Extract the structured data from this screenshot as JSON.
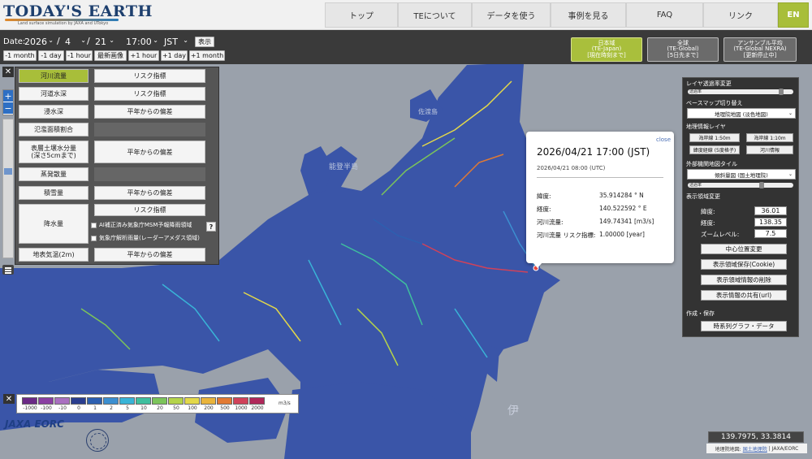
{
  "header": {
    "logo_text": "TODAY'S EARTH",
    "logo_sub": "Land surface simulation by JAXA and UTokyo",
    "nav": [
      {
        "label": "トップ"
      },
      {
        "label": "TEについて"
      },
      {
        "label": "データを使う"
      },
      {
        "label": "事例を見る"
      },
      {
        "label": "FAQ"
      },
      {
        "label": "リンク"
      }
    ],
    "lang": "EN"
  },
  "toolbar": {
    "date_label": "Date:",
    "year": "2026",
    "month": "4",
    "day": "21",
    "time": "17:00",
    "tz": "JST",
    "show": "表示",
    "steps": [
      "-1 month",
      "-1 day",
      "-1 hour",
      "最新画像",
      "+1 hour",
      "+1 day",
      "+1 month"
    ],
    "models": [
      {
        "l1": "日本域",
        "l2": "(TE-Japan)",
        "l3": "[現在時刻まで]",
        "active": true
      },
      {
        "l1": "全球",
        "l2": "(TE-Global)",
        "l3": "[5日先まで]",
        "active": false
      },
      {
        "l1": "アンサンブル平均",
        "l2": "(TE-Global NEXRA)",
        "l3": "[更新停止中]",
        "active": false
      }
    ]
  },
  "layers": {
    "river_flow": "河川流量",
    "risk1": "リスク指標",
    "river_depth": "河道水深",
    "risk2": "リスク指標",
    "flood_depth": "浸水深",
    "anomaly1": "平年からの偏差",
    "inundation": "氾濫面積割合",
    "soil1": "表層土壌水分量",
    "soil2": "(深さ5cmまで)",
    "anomaly2": "平年からの偏差",
    "evap": "蒸発散量",
    "snow": "積雪量",
    "anomaly3": "平年からの偏差",
    "precip": "降水量",
    "risk3": "リスク指標",
    "chk1": "AI補正済み気象庁MSM予報降雨領域",
    "chk2": "気象庁解析雨量(レーダーアメダス領域)",
    "help": "?",
    "temp": "地表気温(2m)",
    "anomaly4": "平年からの偏差"
  },
  "popup": {
    "close": "close",
    "title": "2026/04/21 17:00 (JST)",
    "utc": "2026/04/21 08:00 (UTC)",
    "lat_label": "緯度:",
    "lat_value": "35.914284 °  N",
    "lon_label": "経度:",
    "lon_value": "140.522592 °  E",
    "flow_label": "河川流量:",
    "flow_value": "149.74341 [m3/s]",
    "risk_label": "河川流量 リスク指標:",
    "risk_value": "1.00000 [year]"
  },
  "right_panel": {
    "layer_opacity": "レイヤ透過率変更",
    "opacity_lbl": "透過率",
    "basemap": "ベースマップ切り替え",
    "basemap_value": "地理院地図 (淡色地図)",
    "geo_layer": "地理情報レイヤ",
    "geo_btns": [
      "海岸線 1:50m",
      "海岸線 1:10m",
      "緯度経線 (5度格子)",
      "河川情報"
    ],
    "ext_tile": "外部機関地図タイル",
    "ext_value": "傾斜量図 (国土地理院)",
    "opacity_lbl2": "透過率",
    "region": "表示領域変更",
    "lat_label": "緯度:",
    "lat": "36.01",
    "lon_label": "経度:",
    "lon": "138.35",
    "zoom_label": "ズームレベル:",
    "zoom": "7.5",
    "btn_center": "中心位置変更",
    "btn_save": "表示領域保存(Cookie)",
    "btn_del": "表示領域情報の削除",
    "btn_share": "表示情報の共有(url)",
    "create": "作成・保存",
    "btn_ts": "時系列グラフ・データ"
  },
  "legend": {
    "labels": [
      "-1000",
      "-100",
      "-10",
      "0",
      "1",
      "2",
      "5",
      "10",
      "20",
      "50",
      "100",
      "200",
      "500",
      "1000",
      "2000"
    ],
    "colors": [
      "#6b2a86",
      "#8a3fa2",
      "#a970c0",
      "#2a3d8f",
      "#2d5fb0",
      "#3c8fd0",
      "#39b4d7",
      "#3fbf9e",
      "#7cc45a",
      "#b4d34a",
      "#e3d84a",
      "#e9b43c",
      "#e27a33",
      "#d0425a",
      "#b0285a"
    ],
    "unit": "m3/s"
  },
  "logos": {
    "jaxa": "JAXA EORC"
  },
  "coords": "139.7975, 33.3814",
  "attribution": {
    "prefix": "地理院地図:",
    "link": "国土地理院",
    "sep": "|",
    "org": "JAXA/EORC"
  },
  "map_labels": {
    "sado": "佐渡島",
    "noto": "能登半島",
    "izu": "伊"
  }
}
